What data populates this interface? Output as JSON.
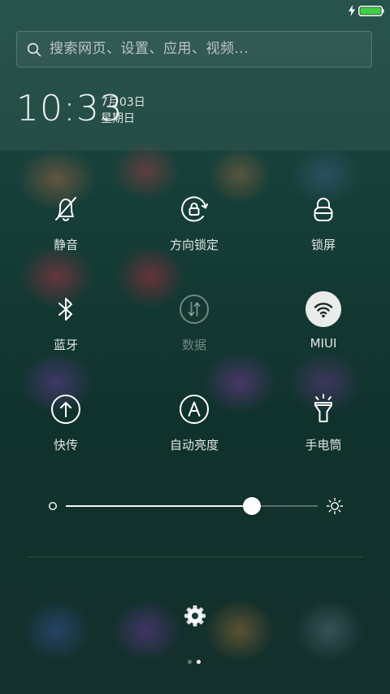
{
  "search": {
    "placeholder": "搜索网页、设置、应用、视频..."
  },
  "clock": {
    "time": "10:33",
    "date": "7月03日",
    "weekday": "星期日"
  },
  "toggles": [
    {
      "label": "静音",
      "icon": "bell-off-icon",
      "state": "off"
    },
    {
      "label": "方向锁定",
      "icon": "rotation-lock-icon",
      "state": "off"
    },
    {
      "label": "锁屏",
      "icon": "lock-icon",
      "state": "off"
    },
    {
      "label": "蓝牙",
      "icon": "bluetooth-icon",
      "state": "off"
    },
    {
      "label": "数据",
      "icon": "mobile-data-icon",
      "state": "disabled"
    },
    {
      "label": "MIUI",
      "icon": "wifi-icon",
      "state": "on"
    },
    {
      "label": "快传",
      "icon": "upload-icon",
      "state": "off"
    },
    {
      "label": "自动亮度",
      "icon": "auto-brightness-icon",
      "state": "off"
    },
    {
      "label": "手电筒",
      "icon": "flashlight-icon",
      "state": "off"
    }
  ],
  "brightness": {
    "level": 0.74
  },
  "pager": {
    "total": 2,
    "current": 2
  },
  "colors": {
    "battery": "#3fd13f",
    "active_toggle": "#e9ecea"
  }
}
